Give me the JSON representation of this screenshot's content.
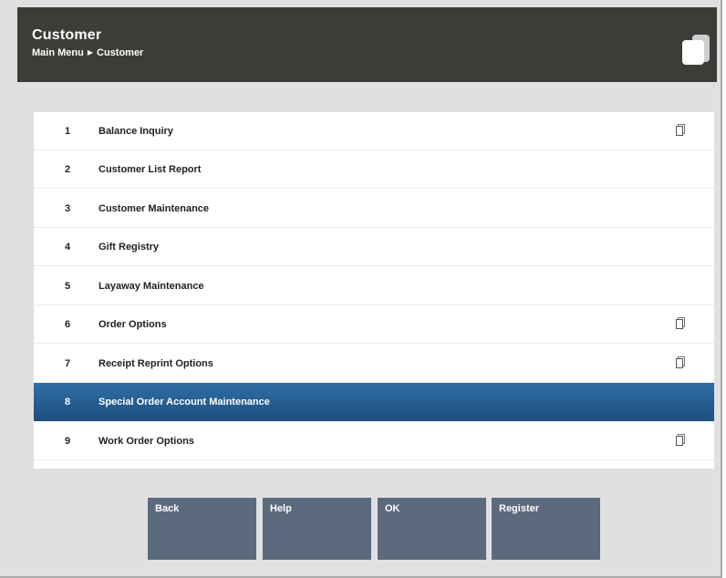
{
  "header": {
    "title": "Customer",
    "breadcrumb": [
      "Main Menu",
      "Customer"
    ],
    "icon": "app-options-icon"
  },
  "menu": {
    "selected_index": 7,
    "items": [
      {
        "number": "1",
        "label": "Balance Inquiry",
        "icon": "submenu-icon"
      },
      {
        "number": "2",
        "label": "Customer List Report",
        "icon": ""
      },
      {
        "number": "3",
        "label": "Customer Maintenance",
        "icon": ""
      },
      {
        "number": "4",
        "label": "Gift Registry",
        "icon": ""
      },
      {
        "number": "5",
        "label": "Layaway Maintenance",
        "icon": ""
      },
      {
        "number": "6",
        "label": "Order Options",
        "icon": "submenu-icon"
      },
      {
        "number": "7",
        "label": "Receipt Reprint Options",
        "icon": "submenu-icon"
      },
      {
        "number": "8",
        "label": "Special Order Account Maintenance",
        "icon": ""
      },
      {
        "number": "9",
        "label": "Work Order Options",
        "icon": "submenu-icon"
      }
    ]
  },
  "buttons": {
    "back": "Back",
    "help": "Help",
    "ok": "OK",
    "register": "Register"
  },
  "colors": {
    "header_bg": "#3e3c38",
    "selected_row": "#24598c",
    "button_bg": "#5b6a7c",
    "page_bg": "#e0e0e0"
  }
}
